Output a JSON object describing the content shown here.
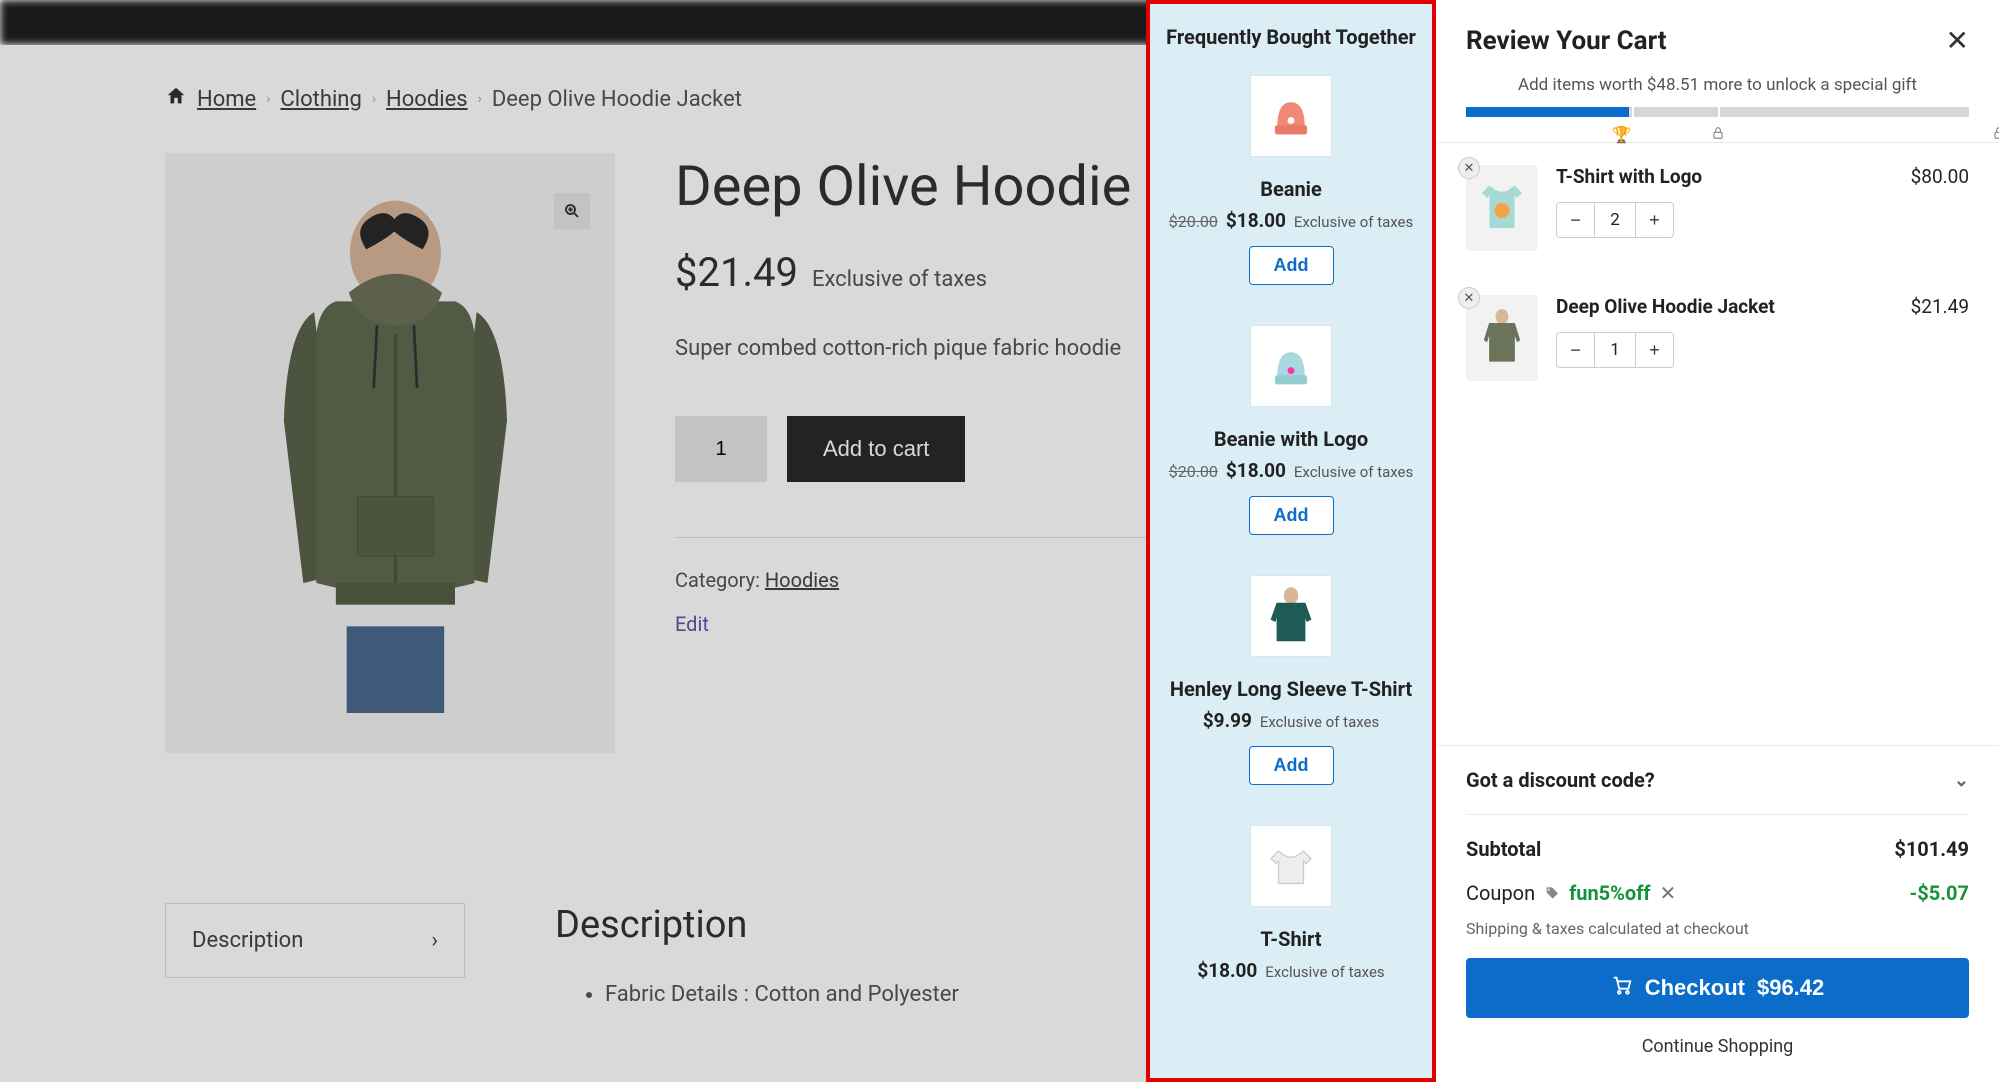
{
  "breadcrumb": {
    "home": "Home",
    "clothing": "Clothing",
    "hoodies": "Hoodies",
    "current": "Deep Olive Hoodie Jacket"
  },
  "product": {
    "title": "Deep Olive Hoodie Jacket",
    "price": "$21.49",
    "tax_note": "Exclusive of taxes",
    "description": "Super combed cotton-rich pique fabric hoodie",
    "qty": "1",
    "add_to_cart": "Add to cart",
    "category_label": "Category: ",
    "category_link": "Hoodies",
    "edit": "Edit"
  },
  "tabs": {
    "description_tab": "Description",
    "description_heading": "Description",
    "bullet1": "Fabric Details : Cotton and Polyester"
  },
  "fbt": {
    "title": "Frequently Bought Together",
    "items": [
      {
        "name": "Beanie",
        "old_price": "$20.00",
        "price": "$18.00",
        "tax": "Exclusive of taxes",
        "add": "Add"
      },
      {
        "name": "Beanie with Logo",
        "old_price": "$20.00",
        "price": "$18.00",
        "tax": "Exclusive of taxes",
        "add": "Add"
      },
      {
        "name": "Henley Long Sleeve T-Shirt",
        "old_price": "",
        "price": "$9.99",
        "tax": "Exclusive of taxes",
        "add": "Add"
      },
      {
        "name": "T-Shirt",
        "old_price": "",
        "price": "$18.00",
        "tax": "Exclusive of taxes",
        "add": "Add"
      }
    ]
  },
  "cart": {
    "title": "Review Your Cart",
    "unlock_text": "Add items worth $48.51 more to unlock a special gift",
    "items": [
      {
        "name": "T-Shirt with Logo",
        "qty": "2",
        "price": "$80.00"
      },
      {
        "name": "Deep Olive Hoodie Jacket",
        "qty": "1",
        "price": "$21.49"
      }
    ],
    "discount_prompt": "Got a discount code?",
    "subtotal_label": "Subtotal",
    "subtotal": "$101.49",
    "coupon_label": "Coupon",
    "coupon_code": "fun5%off",
    "coupon_amount": "-$5.07",
    "ship_note": "Shipping & taxes calculated at checkout",
    "checkout_label": "Checkout",
    "checkout_total": "$96.42",
    "continue": "Continue Shopping"
  }
}
